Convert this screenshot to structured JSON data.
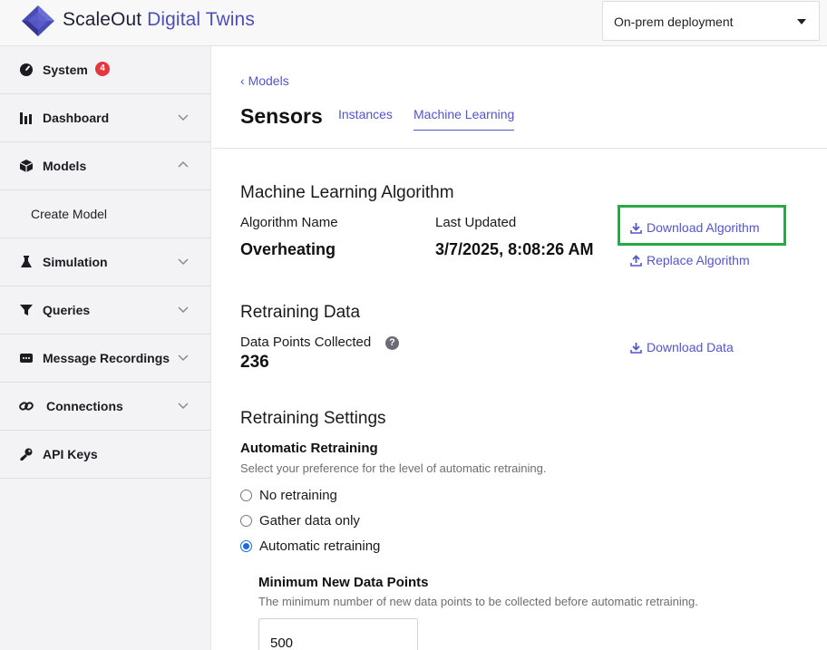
{
  "header": {
    "title_brand": "ScaleOut",
    "title_product": "Digital Twins",
    "deployment_select": {
      "value": "On-prem deployment"
    }
  },
  "sidebar": {
    "items": [
      {
        "label": "System",
        "badge": "4",
        "icon": "system-icon"
      },
      {
        "label": "Dashboard",
        "icon": "dashboard-icon",
        "expanded": false
      },
      {
        "label": "Models",
        "icon": "models-icon",
        "expanded": true
      },
      {
        "label": "Create Model",
        "sub": true
      },
      {
        "label": "Simulation",
        "icon": "simulation-icon",
        "expanded": false
      },
      {
        "label": "Queries",
        "icon": "queries-icon",
        "expanded": false
      },
      {
        "label": "Message Recordings",
        "icon": "message-recordings-icon",
        "expanded": false
      },
      {
        "label": "Connections",
        "icon": "connections-icon",
        "expanded": false
      },
      {
        "label": "API Keys",
        "icon": "api-keys-icon"
      }
    ]
  },
  "main": {
    "back_link": "Models",
    "title": "Sensors",
    "tabs": [
      {
        "label": "Instances",
        "active": false
      },
      {
        "label": "Machine Learning",
        "active": true
      }
    ],
    "ml_algorithm": {
      "section_title": "Machine Learning Algorithm",
      "name_label": "Algorithm Name",
      "name_value": "Overheating",
      "updated_label": "Last Updated",
      "updated_value": "3/7/2025, 8:08:26 AM",
      "download_label": "Download Algorithm",
      "replace_label": "Replace Algorithm"
    },
    "retraining_data": {
      "section_title": "Retraining Data",
      "points_label": "Data Points Collected",
      "points_value": "236",
      "download_label": "Download Data"
    },
    "retraining_settings": {
      "section_title": "Retraining Settings",
      "auto_heading": "Automatic Retraining",
      "auto_desc": "Select your preference for the level of automatic retraining.",
      "options": [
        {
          "label": "No retraining",
          "checked": false
        },
        {
          "label": "Gather data only",
          "checked": false
        },
        {
          "label": "Automatic retraining",
          "checked": true
        }
      ],
      "min_heading": "Minimum New Data Points",
      "min_desc": "The minimum number of new data points to be collected before automatic retraining.",
      "min_value": "500"
    }
  },
  "colors": {
    "accent": "#5355c9",
    "badge": "#e5363d",
    "highlight_box": "#2aa845",
    "radio_checked": "#1a6be0"
  }
}
